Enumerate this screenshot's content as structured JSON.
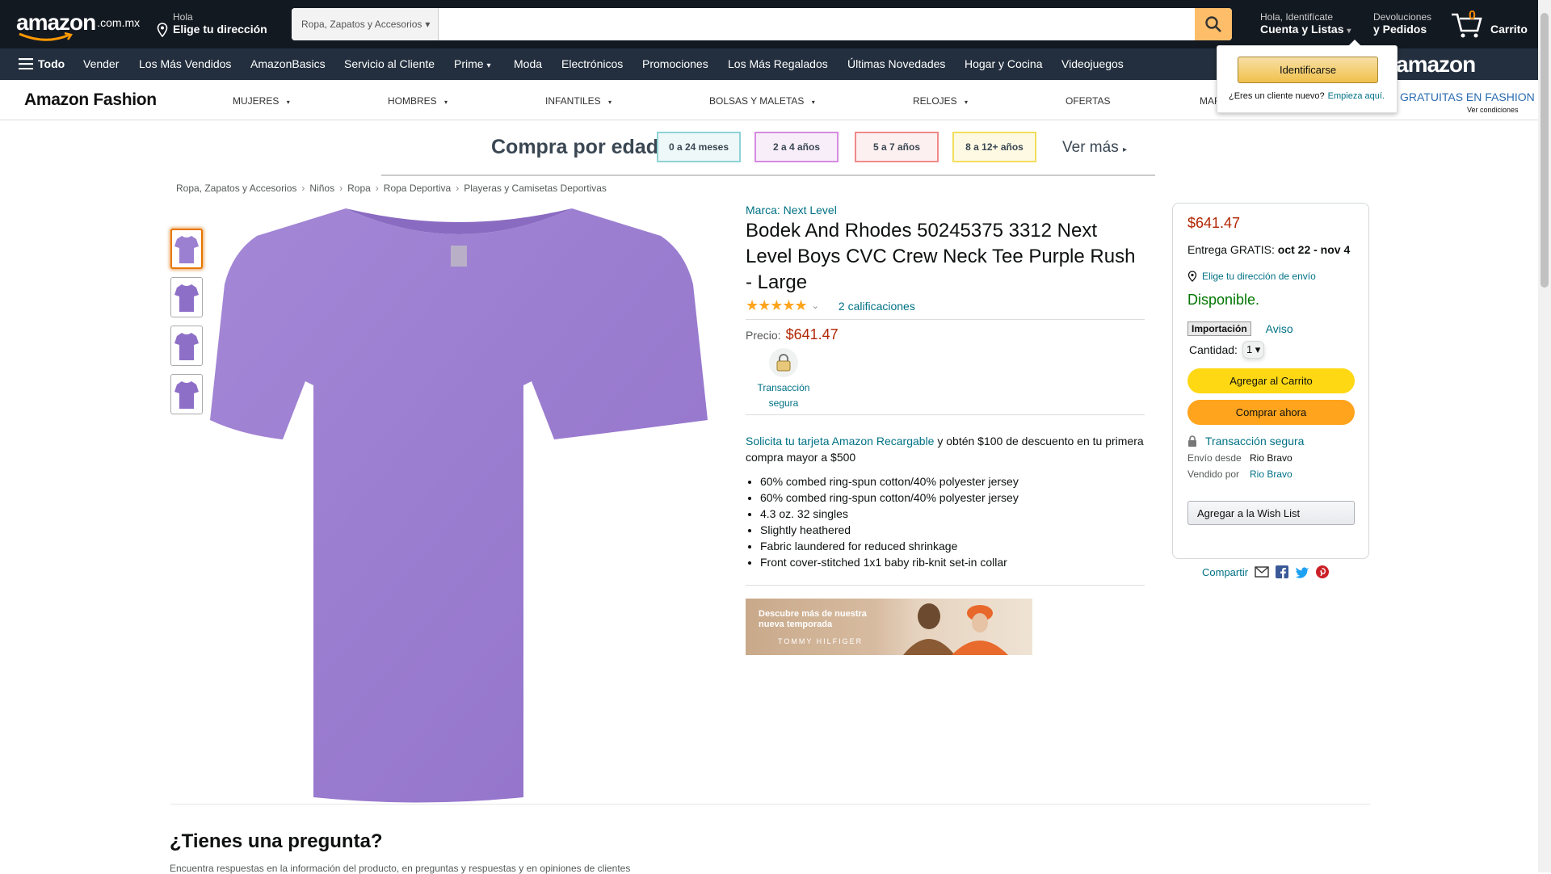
{
  "topnav": {
    "logo_text": "amazon",
    "logo_tld": ".com.mx",
    "address_line1": "Hola",
    "address_line2": "Elige tu dirección",
    "search_category": "Ropa, Zapatos y Accesorios",
    "search_placeholder": "",
    "account_line1": "Hola, Identifícate",
    "account_line2": "Cuenta y Listas",
    "returns_line1": "Devoluciones",
    "returns_line2": "y Pedidos",
    "cart_count": "0",
    "cart_label": "Carrito"
  },
  "subnav": {
    "all_label": "Todo",
    "items": [
      "Vender",
      "Los Más Vendidos",
      "AmazonBasics",
      "Servicio al Cliente",
      "Prime",
      "Moda",
      "Electrónicos",
      "Promociones",
      "Los Más Regalados",
      "Últimas Novedades",
      "Hogar y Cocina",
      "Videojuegos"
    ],
    "music_logo": "amazon music"
  },
  "fashion": {
    "brand": "Amazon Fashion",
    "items": [
      "MUJERES",
      "HOMBRES",
      "INFANTILES",
      "BOLSAS Y MALETAS",
      "RELOJES",
      "OFERTAS",
      "MAR"
    ],
    "promo": "GRATUITAS EN FASHION",
    "promo_note": "Ver condiciones"
  },
  "age_banner": {
    "title": "Compra por edad",
    "options": [
      {
        "label": "0 a 24 meses",
        "color": "#8ed3d6"
      },
      {
        "label": "2 a 4 años",
        "color": "#d58be0"
      },
      {
        "label": "5 a 7 años",
        "color": "#f08a8a"
      },
      {
        "label": "8 a 12+ años",
        "color": "#f3de5c"
      }
    ],
    "more": "Ver más"
  },
  "breadcrumb": [
    "Ropa, Zapatos y Accesorios",
    "Niños",
    "Ropa",
    "Ropa Deportiva",
    "Playeras y Camisetas Deportivas"
  ],
  "product": {
    "brand_link": "Marca: Next Level",
    "title": "Bodek And Rhodes 50245375 3312 Next Level Boys CVC Crew Neck Tee Purple Rush - Large",
    "stars": "★★★★★",
    "ratings": "2 calificaciones",
    "price_label": "Precio:",
    "price": "$641.47",
    "secure_label": "Transacción segura",
    "promo_link": "Solicita tu tarjeta Amazon Recargable",
    "promo_text": " y obtén $100 de descuento en tu primera compra mayor a $500",
    "bullets": [
      "60% combed ring-spun cotton/40% polyester jersey",
      "60% combed ring-spun cotton/40% polyester jersey",
      "4.3 oz. 32 singles",
      "Slightly heathered",
      "Fabric laundered for reduced shrinkage",
      "Front cover-stitched 1x1 baby rib-knit set-in collar"
    ],
    "ad_line1": "Descubre más de nuestra",
    "ad_line2": "nueva temporada",
    "ad_brand": "TOMMY HILFIGER",
    "shirt_color": "#9b7fd0"
  },
  "buybox": {
    "price": "$641.47",
    "delivery_prefix": "Entrega GRATIS: ",
    "delivery_dates": "oct 22 - nov 4",
    "address": "Elige tu dirección de envío",
    "stock": "Disponible.",
    "import_tag": "Importación",
    "notice": "Aviso",
    "qty_label": "Cantidad:",
    "qty_value": "1",
    "add_cart": "Agregar al Carrito",
    "buy_now": "Comprar ahora",
    "secure": "Transacción segura",
    "ships_from_label": "Envío desde",
    "ships_from": "Rio Bravo",
    "sold_by_label": "Vendido por",
    "sold_by": "Rio Bravo",
    "wishlist": "Agregar a la Wish List",
    "share": "Compartir"
  },
  "flyout": {
    "signin": "Identificarse",
    "new_customer": "¿Eres un cliente nuevo?",
    "start_here": "Empieza aquí."
  },
  "questions": {
    "title": "¿Tienes una pregunta?",
    "subtitle": "Encuentra respuestas en la información del producto, en preguntas y respuestas y en opiniones de clientes"
  }
}
